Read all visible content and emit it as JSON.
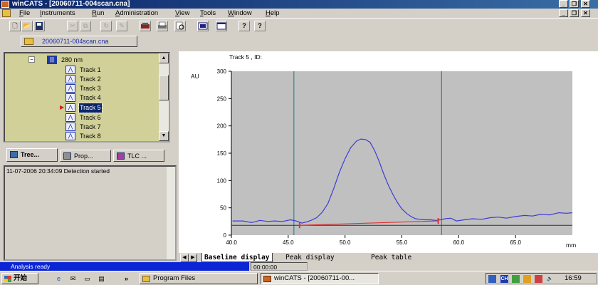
{
  "window": {
    "title": "winCATS - [20060711-004scan.cna]",
    "controls": {
      "minimize": "_",
      "restore": "❐",
      "close": "✕"
    }
  },
  "menu": [
    "File",
    "Instruments",
    "Run",
    "Administration",
    "View",
    "Tools",
    "Window",
    "Help"
  ],
  "toolbar": {
    "buttons": [
      "new-doc-icon",
      "open-icon",
      "save-icon",
      "cut-icon",
      "copy-icon",
      "refresh-icon",
      "edit-icon",
      "instrument-icon",
      "print-icon",
      "print-preview-icon",
      "layout-icon",
      "window-icon",
      "help-icon",
      "context-help-icon"
    ],
    "glyphs": {
      "new": "🗋",
      "open": "📂",
      "save": "💾",
      "help": "?",
      "context_help": "?"
    }
  },
  "document_tab": {
    "label": "20060711-004scan.cna"
  },
  "tree": {
    "wavelength": "280 nm",
    "tracks": [
      "Track 1",
      "Track 2",
      "Track 3",
      "Track 4",
      "Track 5",
      "Track 6",
      "Track 7",
      "Track 8"
    ],
    "selected": "Track 5"
  },
  "left_tabs": [
    "Tree...",
    "Prop...",
    "TLC ..."
  ],
  "log": {
    "line": "11-07-2006 20:34:09 Detection started"
  },
  "chart_data": {
    "type": "line",
    "title": "Track 5 , ID:",
    "ylabel": "AU",
    "xlabel": "mm",
    "xlim": [
      40.0,
      70.0
    ],
    "ylim": [
      0,
      300
    ],
    "x_ticks": [
      "40.0",
      "45.0",
      "50.0",
      "55.0",
      "60.0",
      "65.0"
    ],
    "y_ticks": [
      "0",
      "50",
      "100",
      "150",
      "200",
      "250",
      "300"
    ],
    "x_tick_values": [
      40,
      45,
      50,
      55,
      60,
      65
    ],
    "y_tick_values": [
      0,
      50,
      100,
      150,
      200,
      250,
      300
    ],
    "plot_area_color": "#c0c0c0",
    "outside_color": "#ffffff",
    "signal": {
      "color": "#3b3bd9",
      "x": [
        40.1,
        41.0,
        41.8,
        42.5,
        43.2,
        43.8,
        44.5,
        45.2,
        45.7,
        46.2,
        46.6,
        47.0,
        47.5,
        48.0,
        48.5,
        49.0,
        49.5,
        50.0,
        50.5,
        51.0,
        51.4,
        51.8,
        52.2,
        52.6,
        53.0,
        53.4,
        53.8,
        54.2,
        54.6,
        55.0,
        55.4,
        55.8,
        56.2,
        56.6,
        57.0,
        57.5,
        58.0,
        58.4,
        58.8,
        59.3,
        59.8,
        60.5,
        61.2,
        62.0,
        62.8,
        63.5,
        64.2,
        65.0,
        65.8,
        66.5,
        67.2,
        68.0,
        68.8,
        69.5,
        70.0
      ],
      "y": [
        26,
        26,
        23,
        27,
        25,
        26,
        25,
        28,
        26,
        22,
        24,
        27,
        32,
        42,
        58,
        85,
        115,
        140,
        160,
        172,
        176,
        175,
        170,
        155,
        135,
        112,
        92,
        75,
        60,
        48,
        40,
        34,
        30,
        29,
        28,
        28,
        27,
        28,
        30,
        31,
        26,
        28,
        30,
        29,
        32,
        33,
        31,
        34,
        36,
        35,
        38,
        37,
        41,
        40,
        41
      ]
    },
    "baseline": {
      "color": "#e03030",
      "x": [
        46.0,
        58.2
      ],
      "y": [
        18,
        26
      ]
    },
    "hline": {
      "color": "#303030",
      "y": 18
    },
    "vlines": {
      "color": "#3f8080",
      "x": [
        45.5,
        58.5
      ]
    }
  },
  "bottom_tabs": [
    "Baseline display",
    "Peak display",
    "Peak table"
  ],
  "status": {
    "left": "Analysis ready",
    "time": "00:00:00"
  },
  "taskbar": {
    "start": "开始",
    "tasks": [
      "Program Files",
      "winCATS - [20060711-00..."
    ],
    "clock": "16:59",
    "lang": "CH"
  }
}
